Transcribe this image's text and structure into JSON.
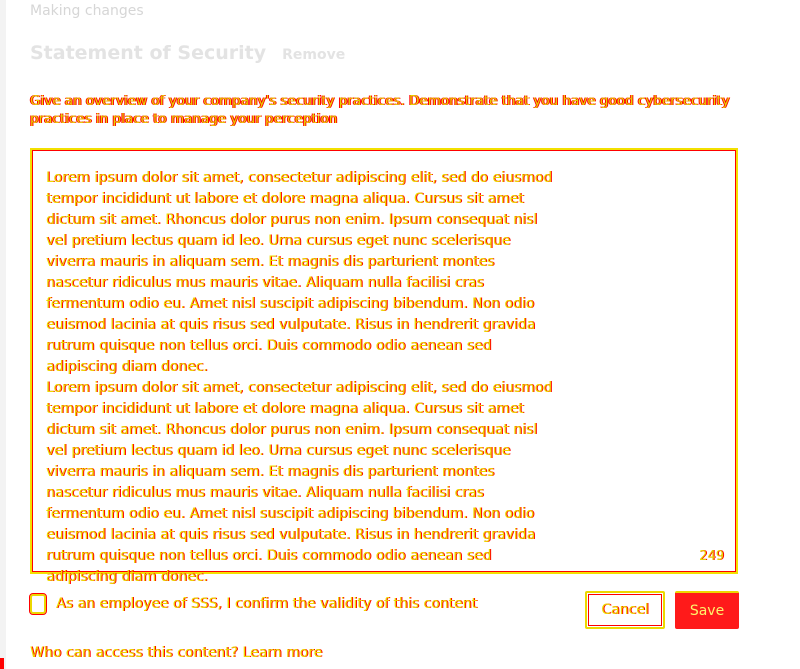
{
  "breadcrumb": "Making changes",
  "section": {
    "title": "Statement of Security",
    "remove_label": "Remove"
  },
  "description": "Give an overview of your company's security practices. Demonstrate that you have good cybersecurity practices in place to manage your perception",
  "editor": {
    "text": "Lorem ipsum dolor sit amet, consectetur adipiscing elit, sed do eiusmod tempor incididunt ut labore et dolore magna aliqua. Cursus sit amet dictum sit amet. Rhoncus dolor purus non enim. Ipsum consequat nisl vel pretium lectus quam id leo. Urna cursus eget nunc scelerisque viverra mauris in aliquam sem. Et magnis dis parturient montes nascetur ridiculus mus mauris vitae. Aliquam nulla facilisi cras fermentum odio eu. Amet nisl suscipit adipiscing bibendum. Non odio euismod lacinia at quis risus sed vulputate. Risus in hendrerit gravida rutrum quisque non tellus orci. Duis commodo odio aenean sed adipiscing diam donec.\nLorem ipsum dolor sit amet, consectetur adipiscing elit, sed do eiusmod tempor incididunt ut labore et dolore magna aliqua. Cursus sit amet dictum sit amet. Rhoncus dolor purus non enim. Ipsum consequat nisl vel pretium lectus quam id leo. Urna cursus eget nunc scelerisque viverra mauris in aliquam sem. Et magnis dis parturient montes nascetur ridiculus mus mauris vitae. Aliquam nulla facilisi cras fermentum odio eu. Amet nisl suscipit adipiscing bibendum. Non odio euismod lacinia at quis risus sed vulputate. Risus in hendrerit gravida rutrum quisque non tellus orci. Duis commodo odio aenean sed adipiscing diam donec.",
    "char_count": "249"
  },
  "confirm": {
    "label": "As an employee of SSS, I confirm the validity of this content"
  },
  "buttons": {
    "cancel": "Cancel",
    "save": "Save"
  },
  "access_link": "Who can access this content? Learn more",
  "colors": {
    "text_yellow": "#ecd800",
    "outline_red": "#ff0000",
    "save_bg": "#ff1a1a",
    "muted": "#e3e3e3"
  }
}
